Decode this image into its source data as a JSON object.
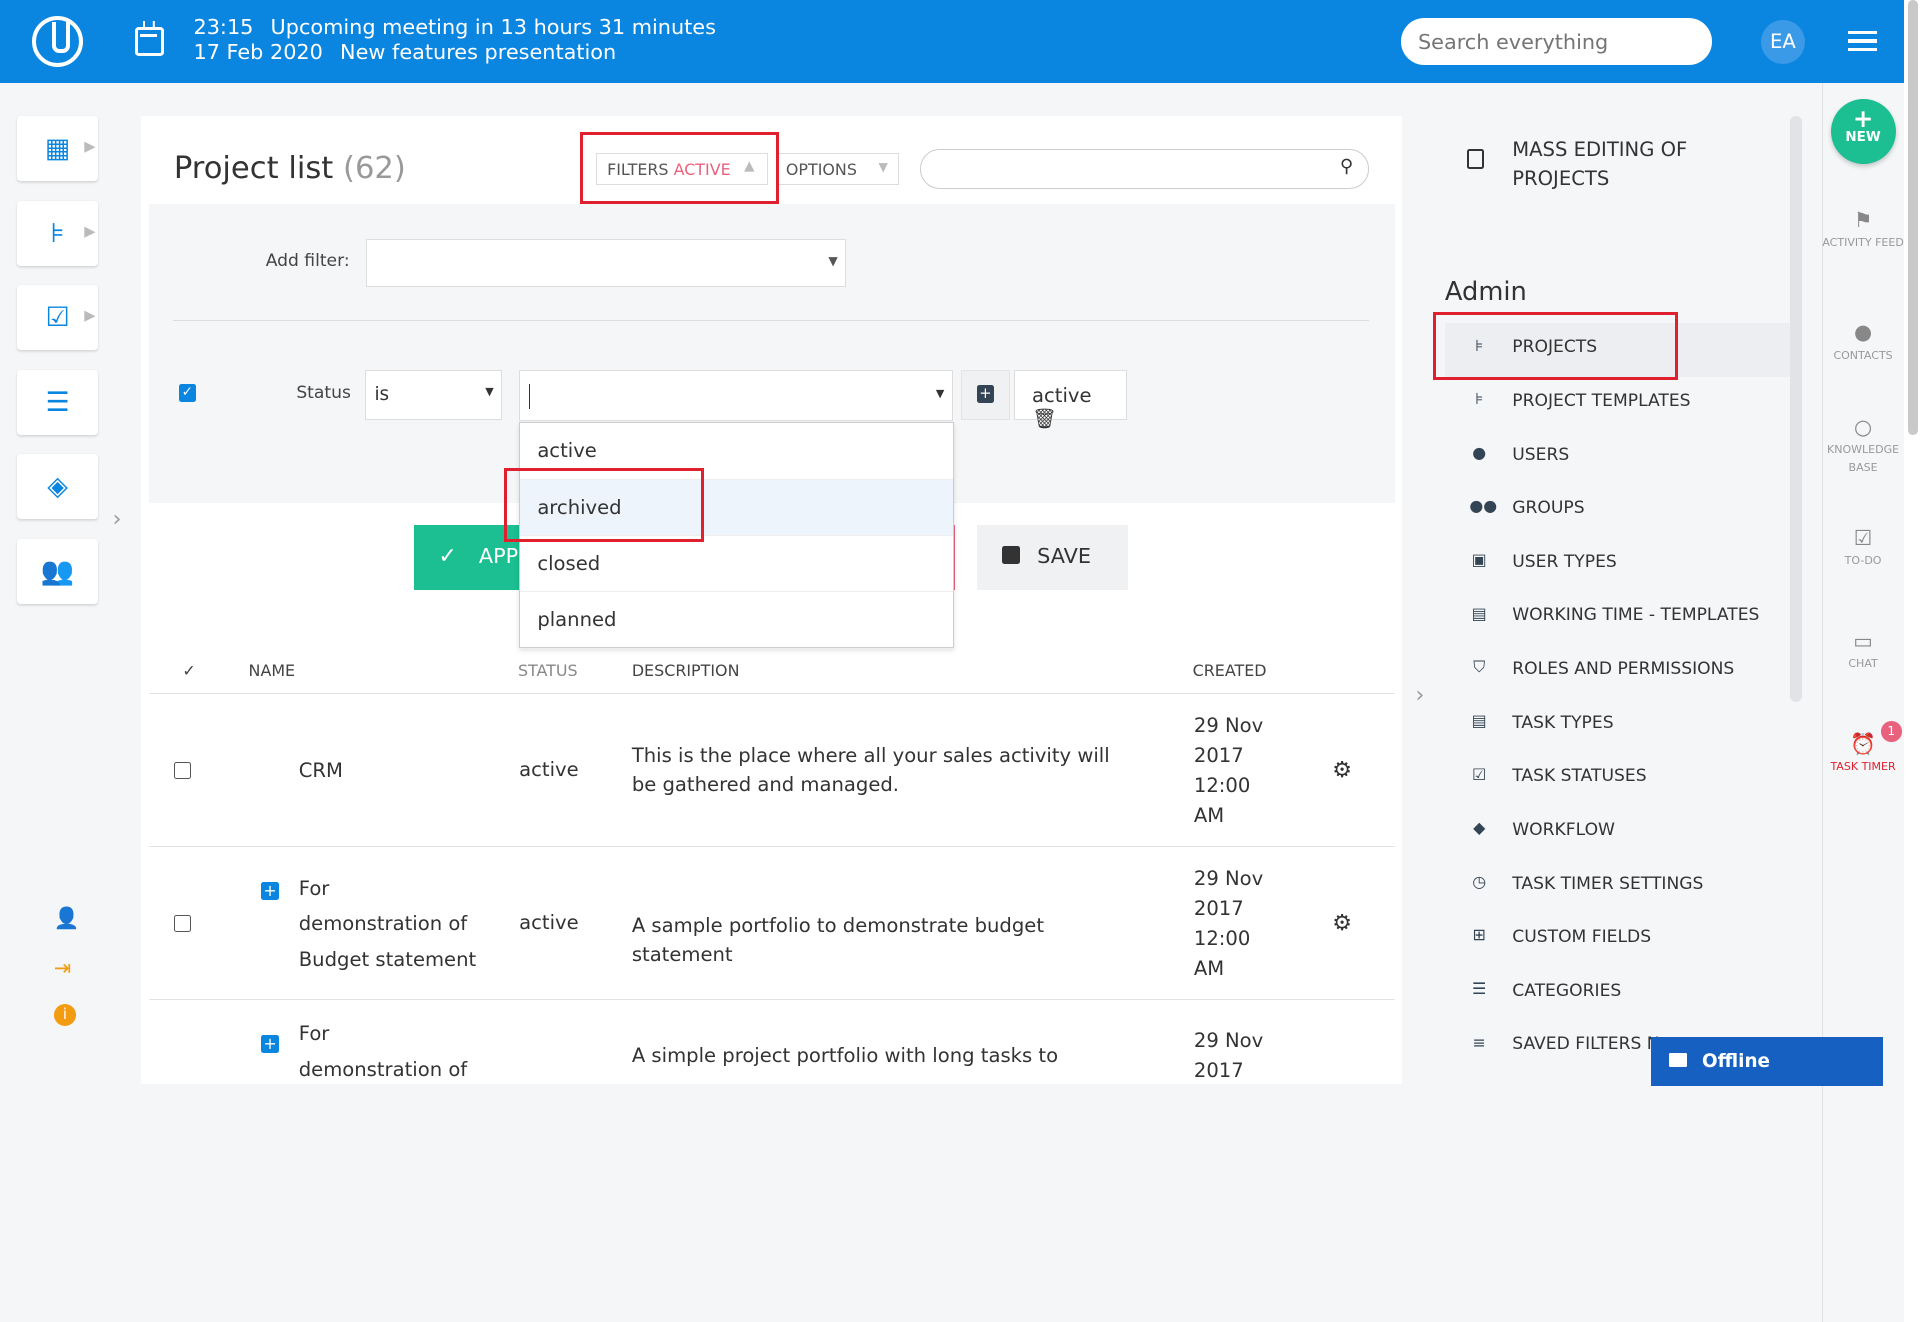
{
  "topbar": {
    "time": "23:15",
    "meeting_title": "Upcoming meeting in 13 hours 31 minutes",
    "date": "17 Feb 2020",
    "meeting_name": "New features presentation",
    "search_placeholder": "Search everything",
    "avatar": "EA"
  },
  "page": {
    "title": "Project list",
    "count": "(62)",
    "filters_label": "FILTERS",
    "filters_state": "ACTIVE",
    "options_label": "OPTIONS"
  },
  "filters": {
    "add_filter_label": "Add filter:",
    "status_label": "Status",
    "operator_value": "is",
    "active_tag": "active",
    "dropdown_options": [
      "active",
      "archived",
      "closed",
      "planned"
    ],
    "apply_label": "APPLY",
    "save_label": "SAVE"
  },
  "table": {
    "headers": {
      "check": "✓",
      "name": "NAME",
      "status": "STATUS",
      "description": "DESCRIPTION",
      "created": "CREATED"
    },
    "rows": [
      {
        "name": "CRM",
        "status": "active",
        "description": "This is the place where all your sales activity will be gathered and managed.",
        "created": "29 Nov 2017 12:00 AM"
      },
      {
        "name": "For demonstration of Budget statement",
        "status": "active",
        "description": "A sample portfolio to demonstrate budget statement",
        "created": "29 Nov 2017 12:00 AM"
      },
      {
        "name": "For demonstration of",
        "status": "",
        "description": "A simple project portfolio with long tasks to",
        "created": "29 Nov 2017"
      }
    ]
  },
  "right_panel": {
    "mass_edit": "MASS EDITING OF PROJECTS",
    "admin_title": "Admin",
    "admin_items": [
      "PROJECTS",
      "PROJECT TEMPLATES",
      "USERS",
      "GROUPS",
      "USER TYPES",
      "WORKING TIME - TEMPLATES",
      "ROLES AND PERMISSIONS",
      "TASK TYPES",
      "TASK STATUSES",
      "WORKFLOW",
      "TASK TIMER SETTINGS",
      "CUSTOM FIELDS",
      "CATEGORIES",
      "SAVED FILTERS N"
    ]
  },
  "farbar": {
    "new_label": "NEW",
    "activity_feed": "ACTIVITY FEED",
    "contacts": "CONTACTS",
    "knowledge_base": "KNOWLEDGE BASE",
    "todo": "TO-DO",
    "chat": "CHAT",
    "task_timer": "TASK TIMER",
    "timer_badge": "1"
  },
  "offline_label": "Offline",
  "colors": {
    "accent": "#0a85e0",
    "green": "#1bbf92",
    "pink": "#e9627d",
    "highlight_box": "#e0202e"
  }
}
